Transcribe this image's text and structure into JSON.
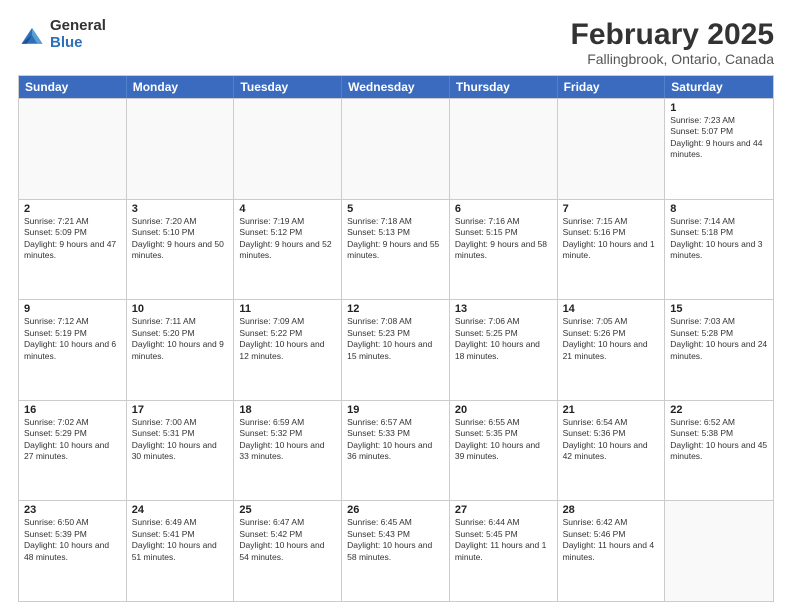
{
  "logo": {
    "general": "General",
    "blue": "Blue"
  },
  "title": {
    "month": "February 2025",
    "location": "Fallingbrook, Ontario, Canada"
  },
  "header_days": [
    "Sunday",
    "Monday",
    "Tuesday",
    "Wednesday",
    "Thursday",
    "Friday",
    "Saturday"
  ],
  "weeks": [
    [
      {
        "day": "",
        "info": ""
      },
      {
        "day": "",
        "info": ""
      },
      {
        "day": "",
        "info": ""
      },
      {
        "day": "",
        "info": ""
      },
      {
        "day": "",
        "info": ""
      },
      {
        "day": "",
        "info": ""
      },
      {
        "day": "1",
        "info": "Sunrise: 7:23 AM\nSunset: 5:07 PM\nDaylight: 9 hours and 44 minutes."
      }
    ],
    [
      {
        "day": "2",
        "info": "Sunrise: 7:21 AM\nSunset: 5:09 PM\nDaylight: 9 hours and 47 minutes."
      },
      {
        "day": "3",
        "info": "Sunrise: 7:20 AM\nSunset: 5:10 PM\nDaylight: 9 hours and 50 minutes."
      },
      {
        "day": "4",
        "info": "Sunrise: 7:19 AM\nSunset: 5:12 PM\nDaylight: 9 hours and 52 minutes."
      },
      {
        "day": "5",
        "info": "Sunrise: 7:18 AM\nSunset: 5:13 PM\nDaylight: 9 hours and 55 minutes."
      },
      {
        "day": "6",
        "info": "Sunrise: 7:16 AM\nSunset: 5:15 PM\nDaylight: 9 hours and 58 minutes."
      },
      {
        "day": "7",
        "info": "Sunrise: 7:15 AM\nSunset: 5:16 PM\nDaylight: 10 hours and 1 minute."
      },
      {
        "day": "8",
        "info": "Sunrise: 7:14 AM\nSunset: 5:18 PM\nDaylight: 10 hours and 3 minutes."
      }
    ],
    [
      {
        "day": "9",
        "info": "Sunrise: 7:12 AM\nSunset: 5:19 PM\nDaylight: 10 hours and 6 minutes."
      },
      {
        "day": "10",
        "info": "Sunrise: 7:11 AM\nSunset: 5:20 PM\nDaylight: 10 hours and 9 minutes."
      },
      {
        "day": "11",
        "info": "Sunrise: 7:09 AM\nSunset: 5:22 PM\nDaylight: 10 hours and 12 minutes."
      },
      {
        "day": "12",
        "info": "Sunrise: 7:08 AM\nSunset: 5:23 PM\nDaylight: 10 hours and 15 minutes."
      },
      {
        "day": "13",
        "info": "Sunrise: 7:06 AM\nSunset: 5:25 PM\nDaylight: 10 hours and 18 minutes."
      },
      {
        "day": "14",
        "info": "Sunrise: 7:05 AM\nSunset: 5:26 PM\nDaylight: 10 hours and 21 minutes."
      },
      {
        "day": "15",
        "info": "Sunrise: 7:03 AM\nSunset: 5:28 PM\nDaylight: 10 hours and 24 minutes."
      }
    ],
    [
      {
        "day": "16",
        "info": "Sunrise: 7:02 AM\nSunset: 5:29 PM\nDaylight: 10 hours and 27 minutes."
      },
      {
        "day": "17",
        "info": "Sunrise: 7:00 AM\nSunset: 5:31 PM\nDaylight: 10 hours and 30 minutes."
      },
      {
        "day": "18",
        "info": "Sunrise: 6:59 AM\nSunset: 5:32 PM\nDaylight: 10 hours and 33 minutes."
      },
      {
        "day": "19",
        "info": "Sunrise: 6:57 AM\nSunset: 5:33 PM\nDaylight: 10 hours and 36 minutes."
      },
      {
        "day": "20",
        "info": "Sunrise: 6:55 AM\nSunset: 5:35 PM\nDaylight: 10 hours and 39 minutes."
      },
      {
        "day": "21",
        "info": "Sunrise: 6:54 AM\nSunset: 5:36 PM\nDaylight: 10 hours and 42 minutes."
      },
      {
        "day": "22",
        "info": "Sunrise: 6:52 AM\nSunset: 5:38 PM\nDaylight: 10 hours and 45 minutes."
      }
    ],
    [
      {
        "day": "23",
        "info": "Sunrise: 6:50 AM\nSunset: 5:39 PM\nDaylight: 10 hours and 48 minutes."
      },
      {
        "day": "24",
        "info": "Sunrise: 6:49 AM\nSunset: 5:41 PM\nDaylight: 10 hours and 51 minutes."
      },
      {
        "day": "25",
        "info": "Sunrise: 6:47 AM\nSunset: 5:42 PM\nDaylight: 10 hours and 54 minutes."
      },
      {
        "day": "26",
        "info": "Sunrise: 6:45 AM\nSunset: 5:43 PM\nDaylight: 10 hours and 58 minutes."
      },
      {
        "day": "27",
        "info": "Sunrise: 6:44 AM\nSunset: 5:45 PM\nDaylight: 11 hours and 1 minute."
      },
      {
        "day": "28",
        "info": "Sunrise: 6:42 AM\nSunset: 5:46 PM\nDaylight: 11 hours and 4 minutes."
      },
      {
        "day": "",
        "info": ""
      }
    ]
  ]
}
